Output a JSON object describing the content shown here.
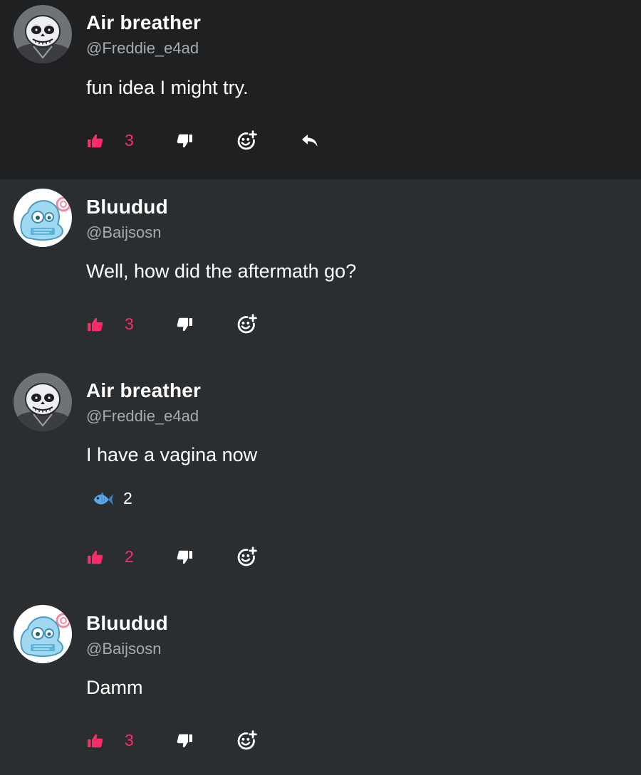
{
  "colors": {
    "accent": "#ff2a6a",
    "background": "#2b2e30",
    "highlight_row": "#1f2021",
    "muted_text": "#a7abae"
  },
  "comments": [
    {
      "avatar": "skeleton-avatar",
      "username": "Air breather",
      "handle": "@Freddie_e4ad",
      "text": "fun idea I might try.",
      "likes": "3",
      "has_reply": true
    },
    {
      "avatar": "blue-blob-avatar",
      "username": "Bluudud",
      "handle": "@Baijsosn",
      "text": "Well, how did the aftermath go?",
      "likes": "3"
    },
    {
      "avatar": "skeleton-avatar",
      "username": "Air breather",
      "handle": "@Freddie_e4ad",
      "text": "I have a vagina now",
      "reaction": {
        "icon": "fish-icon",
        "count": "2"
      },
      "likes": "2"
    },
    {
      "avatar": "blue-blob-avatar",
      "username": "Bluudud",
      "handle": "@Baijsosn",
      "text": "Damm",
      "likes": "3"
    }
  ]
}
